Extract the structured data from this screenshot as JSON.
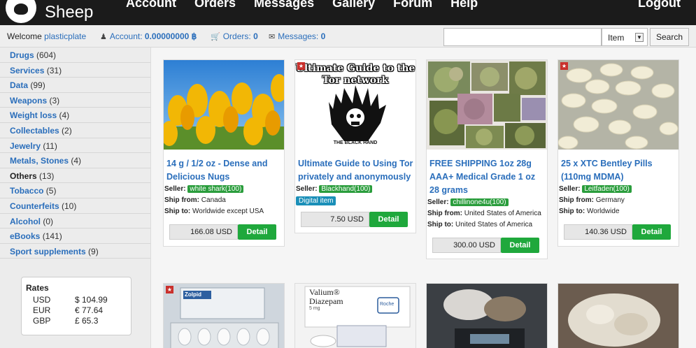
{
  "brand": {
    "name": "Sheep"
  },
  "nav": {
    "items": [
      "Account",
      "Orders",
      "Messages",
      "Gallery",
      "Forum",
      "Help"
    ],
    "logout": "Logout"
  },
  "subbar": {
    "welcome_prefix": "Welcome",
    "username": "plasticplate",
    "account_label": "Account:",
    "account_value": "0.00000000 ฿",
    "orders_label": "Orders:",
    "orders_value": "0",
    "messages_label": "Messages:",
    "messages_value": "0"
  },
  "search": {
    "placeholder": "",
    "select_value": "Item",
    "button": "Search"
  },
  "categories": [
    {
      "name": "Drugs",
      "count": "(604)"
    },
    {
      "name": "Services",
      "count": "(31)"
    },
    {
      "name": "Data",
      "count": "(99)"
    },
    {
      "name": "Weapons",
      "count": "(3)"
    },
    {
      "name": "Weight loss",
      "count": "(4)"
    },
    {
      "name": "Collectables",
      "count": "(2)"
    },
    {
      "name": "Jewelry",
      "count": "(11)"
    },
    {
      "name": "Metals, Stones",
      "count": "(4)"
    },
    {
      "name": "Others",
      "count": "(13)"
    },
    {
      "name": "Tobacco",
      "count": "(5)"
    },
    {
      "name": "Counterfeits",
      "count": "(10)"
    },
    {
      "name": "Alcohol",
      "count": "(0)"
    },
    {
      "name": "eBooks",
      "count": "(141)"
    },
    {
      "name": "Sport supplements",
      "count": "(9)"
    }
  ],
  "rates": {
    "title": "Rates",
    "rows": [
      {
        "currency": "USD",
        "value": "$ 104.99"
      },
      {
        "currency": "EUR",
        "value": "€ 77.64"
      },
      {
        "currency": "GBP",
        "value": "£ 65.3"
      }
    ]
  },
  "labels": {
    "seller": "Seller:",
    "ship_from": "Ship from:",
    "ship_to": "Ship to:",
    "detail": "Detail"
  },
  "products": [
    {
      "title": "14 g / 1/2 oz - Dense and Delicious Nugs",
      "seller": "white shark(100)",
      "ship_from": "Canada",
      "ship_to": "Worldwide except USA",
      "price": "166.08 USD"
    },
    {
      "title": "Ultimate Guide to Using Tor privately and anonymously",
      "seller": "Blackhand(100)",
      "tag": "Digital item",
      "price": "7.50 USD",
      "image_text": "Ultimate Guide to the Tor network",
      "image_caption": "THE BLACK HAND"
    },
    {
      "title": "FREE SHIPPING 1oz 28g AAA+ Medical Grade 1 oz 28 grams",
      "seller": "chillinone4u(100)",
      "ship_from": "United States of America",
      "ship_to": "United States of America",
      "price": "300.00 USD"
    },
    {
      "title": "25 x XTC Bentley Pills (110mg MDMA)",
      "seller": "Leitfaden(100)",
      "ship_from": "Germany",
      "ship_to": "Worldwide",
      "price": "140.36 USD"
    }
  ],
  "second_row": [
    {
      "image_text": "Zolpid"
    },
    {
      "image_text": "Valium®",
      "image_sub": "Diazepam",
      "image_dose": "5 mg",
      "image_brand": "Roche"
    },
    {
      "image_text": ""
    },
    {
      "image_text": ""
    }
  ]
}
